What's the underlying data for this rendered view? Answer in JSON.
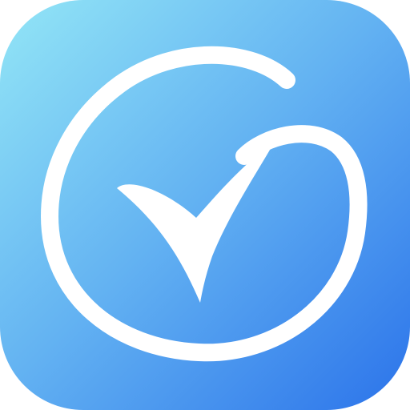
{
  "icon": {
    "name": "checkmark-circle-app-icon",
    "colors": {
      "gradient_start": "#93E6F6",
      "gradient_mid": "#63B2F2",
      "gradient_end": "#2B73EA",
      "glyph": "#FFFFFF"
    }
  }
}
